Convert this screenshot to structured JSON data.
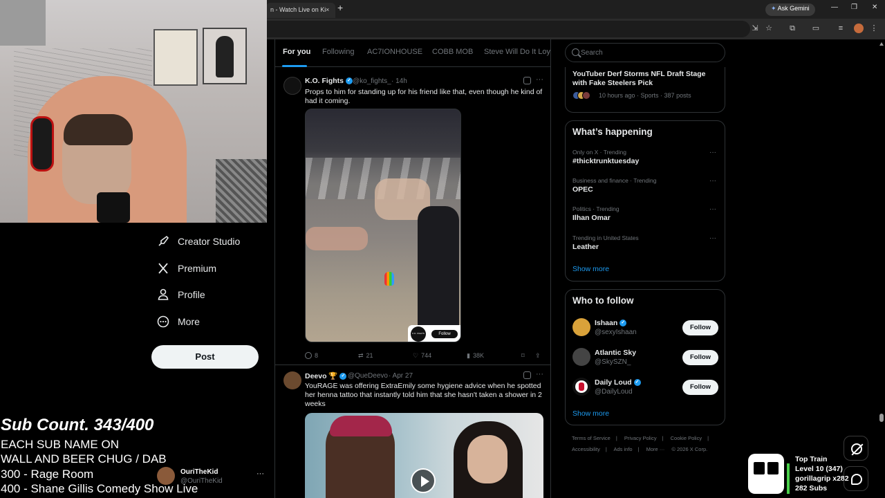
{
  "browser": {
    "tab_title": "n - Watch Live on Ki",
    "tab_close": "×",
    "new_tab": "+",
    "ask_gemini": "Ask Gemini"
  },
  "x_nav": {
    "items": [
      {
        "label": "Creator Studio",
        "icon": "creator-studio-icon"
      },
      {
        "label": "Premium",
        "icon": "x-logo-icon"
      },
      {
        "label": "Profile",
        "icon": "profile-icon"
      },
      {
        "label": "More",
        "icon": "more-circle-icon"
      }
    ],
    "post_button": "Post",
    "account": {
      "name": "OuriTheKid",
      "handle": "@OuriTheKid",
      "more": "···"
    }
  },
  "overlay": {
    "sub_count": "Sub Count. 343/400",
    "lines": [
      "EACH SUB NAME ON",
      "WALL AND BEER CHUG / DAB",
      "300 - Rage Room",
      "400 - Shane Gillis Comedy Show Live"
    ]
  },
  "feed_tabs": [
    "For you",
    "Following",
    "AC7IONHOUSE",
    "COBB MOB",
    "Steve Will Do It Loyal"
  ],
  "tweets": [
    {
      "name": "K.O. Fights",
      "handle": "@ko_fights_",
      "time": "· 14h",
      "text": "Props to him for standing up for his friend like that, even though he kind of had it coming.",
      "media_follow": "Follow",
      "media_logo": "K.O. FIGHTS",
      "replies": "8",
      "reposts": "21",
      "likes": "744",
      "views": "38K"
    },
    {
      "name": "Deevo 🏆",
      "handle": "@QueDeevo",
      "time": "· Apr 27",
      "text": "YouRAGE was offering ExtraEmily some hygiene advice when he spotted her henna tattoo that instantly told him that she hasn't taken a shower in 2 weeks"
    }
  ],
  "search": {
    "placeholder": "Search"
  },
  "news": {
    "title": "YouTuber Derf Storms NFL Draft Stage with Fake Steelers Pick",
    "meta": "10 hours ago · Sports · 387 posts"
  },
  "happening": {
    "heading": "What’s happening",
    "trends": [
      {
        "meta": "Only on X · Trending",
        "name": "#thicktrunktuesday"
      },
      {
        "meta": "Business and finance · Trending",
        "name": "OPEC"
      },
      {
        "meta": "Politics · Trending",
        "name": "Ilhan Omar"
      },
      {
        "meta": "Trending in United States",
        "name": "Leather"
      }
    ],
    "show_more": "Show more"
  },
  "who_to_follow": {
    "heading": "Who to follow",
    "users": [
      {
        "name": "Ishaan",
        "handle": "@sexyIshaan",
        "button": "Follow",
        "verified": true
      },
      {
        "name": "Atlantic Sky",
        "handle": "@SkySZN_",
        "button": "Follow",
        "verified": false
      },
      {
        "name": "Daily Loud",
        "handle": "@DailyLoud",
        "button": "Follow",
        "verified": true
      }
    ],
    "show_more": "Show more"
  },
  "footer": {
    "row1": [
      "Terms of Service",
      "|",
      "Privacy Policy",
      "|",
      "Cookie Policy",
      "|"
    ],
    "row2": [
      "Accessibility",
      "|",
      "Ads info",
      "|",
      "More ···",
      "© 2026 X Corp."
    ]
  },
  "hype_train": {
    "title": "Top Train",
    "level": "Level 10  (347)",
    "gifter": "gorillagrip x282",
    "subs": "282 Subs"
  },
  "colors": {
    "accent": "#1d9bf0",
    "background": "#000000",
    "border": "#2f3336",
    "muted_text": "#71767b"
  }
}
